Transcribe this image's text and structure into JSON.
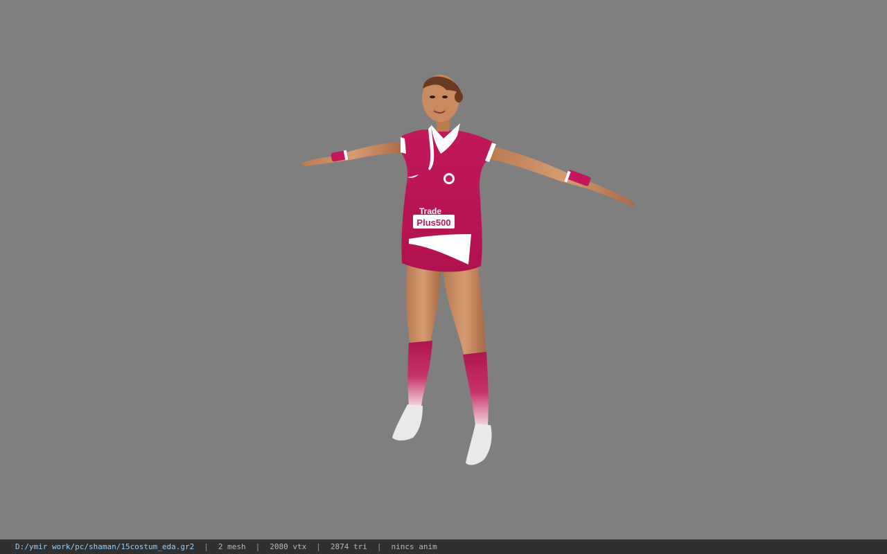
{
  "viewport": {
    "background_color": "#7f7f7f",
    "model": {
      "jersey_color": "#c2185b",
      "jersey_text_line1": "Trade",
      "jersey_text_line2": "Plus500"
    }
  },
  "status": {
    "file_path": "D:/ymir work/pc/shaman/15costum_eda.gr2",
    "mesh_count": "2 mesh",
    "vertex_count": "2080 vtx",
    "tri_count": "2874 tri",
    "anim": "nincs anim",
    "separator": "|"
  }
}
